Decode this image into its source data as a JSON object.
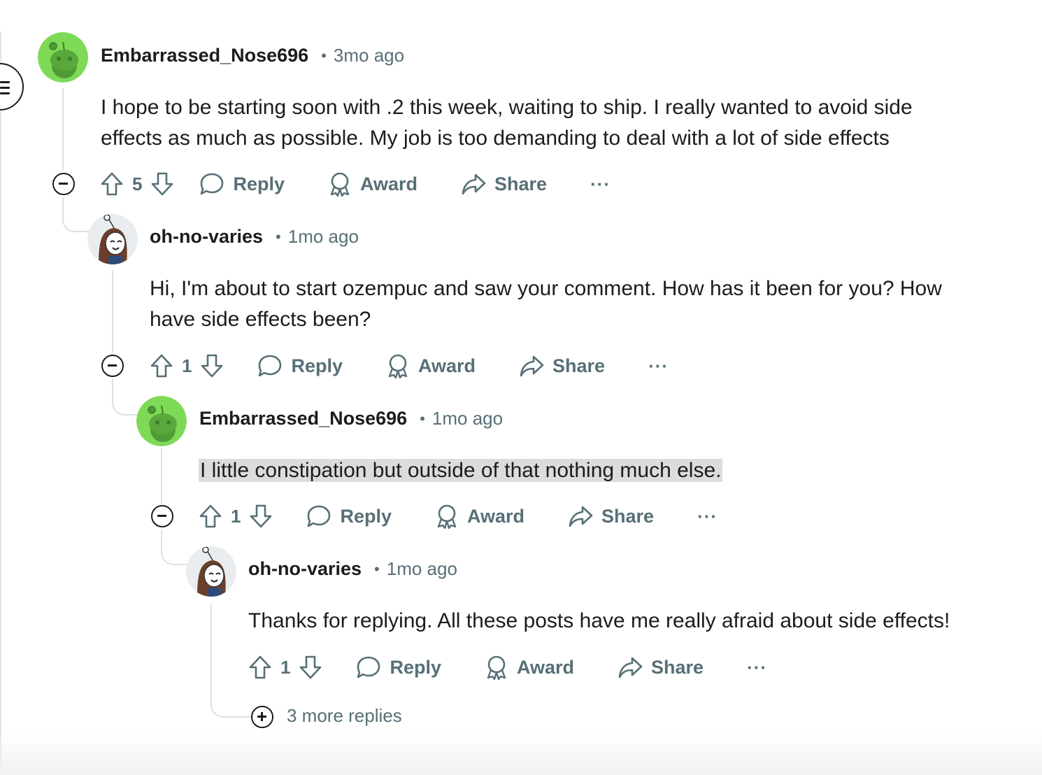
{
  "comments": [
    {
      "username": "Embarrassed_Nose696",
      "dot": "•",
      "time": "3mo ago",
      "lines": [
        "I hope to be starting soon with .2 this week, waiting to ship. I really wanted to avoid side",
        "effects as much as possible. My job is too demanding to deal with a lot of side effects"
      ],
      "votes": "5",
      "avatar": "green-snoo"
    },
    {
      "username": "oh-no-varies",
      "dot": "•",
      "time": "1mo ago",
      "lines": [
        "Hi, I'm about to start ozempuc and saw your comment. How has it been for you? How",
        "have side effects been?"
      ],
      "votes": "1",
      "avatar": "girl-snoo"
    },
    {
      "username": "Embarrassed_Nose696",
      "dot": "•",
      "time": "1mo ago",
      "lines": [
        "I little constipation but outside of that nothing much else."
      ],
      "votes": "1",
      "avatar": "green-snoo"
    },
    {
      "username": "oh-no-varies",
      "dot": "•",
      "time": "1mo ago",
      "lines": [
        "Thanks for replying. All these posts have me really afraid about side effects!"
      ],
      "votes": "1",
      "avatar": "girl-snoo"
    }
  ],
  "actions": {
    "reply": "Reply",
    "award": "Award",
    "share": "Share",
    "more": "···"
  },
  "more_replies": "3 more replies",
  "colors": {
    "meta_gray": "#576f76",
    "avatar_green": "#7ed957",
    "highlight": "#dcdcdc"
  }
}
